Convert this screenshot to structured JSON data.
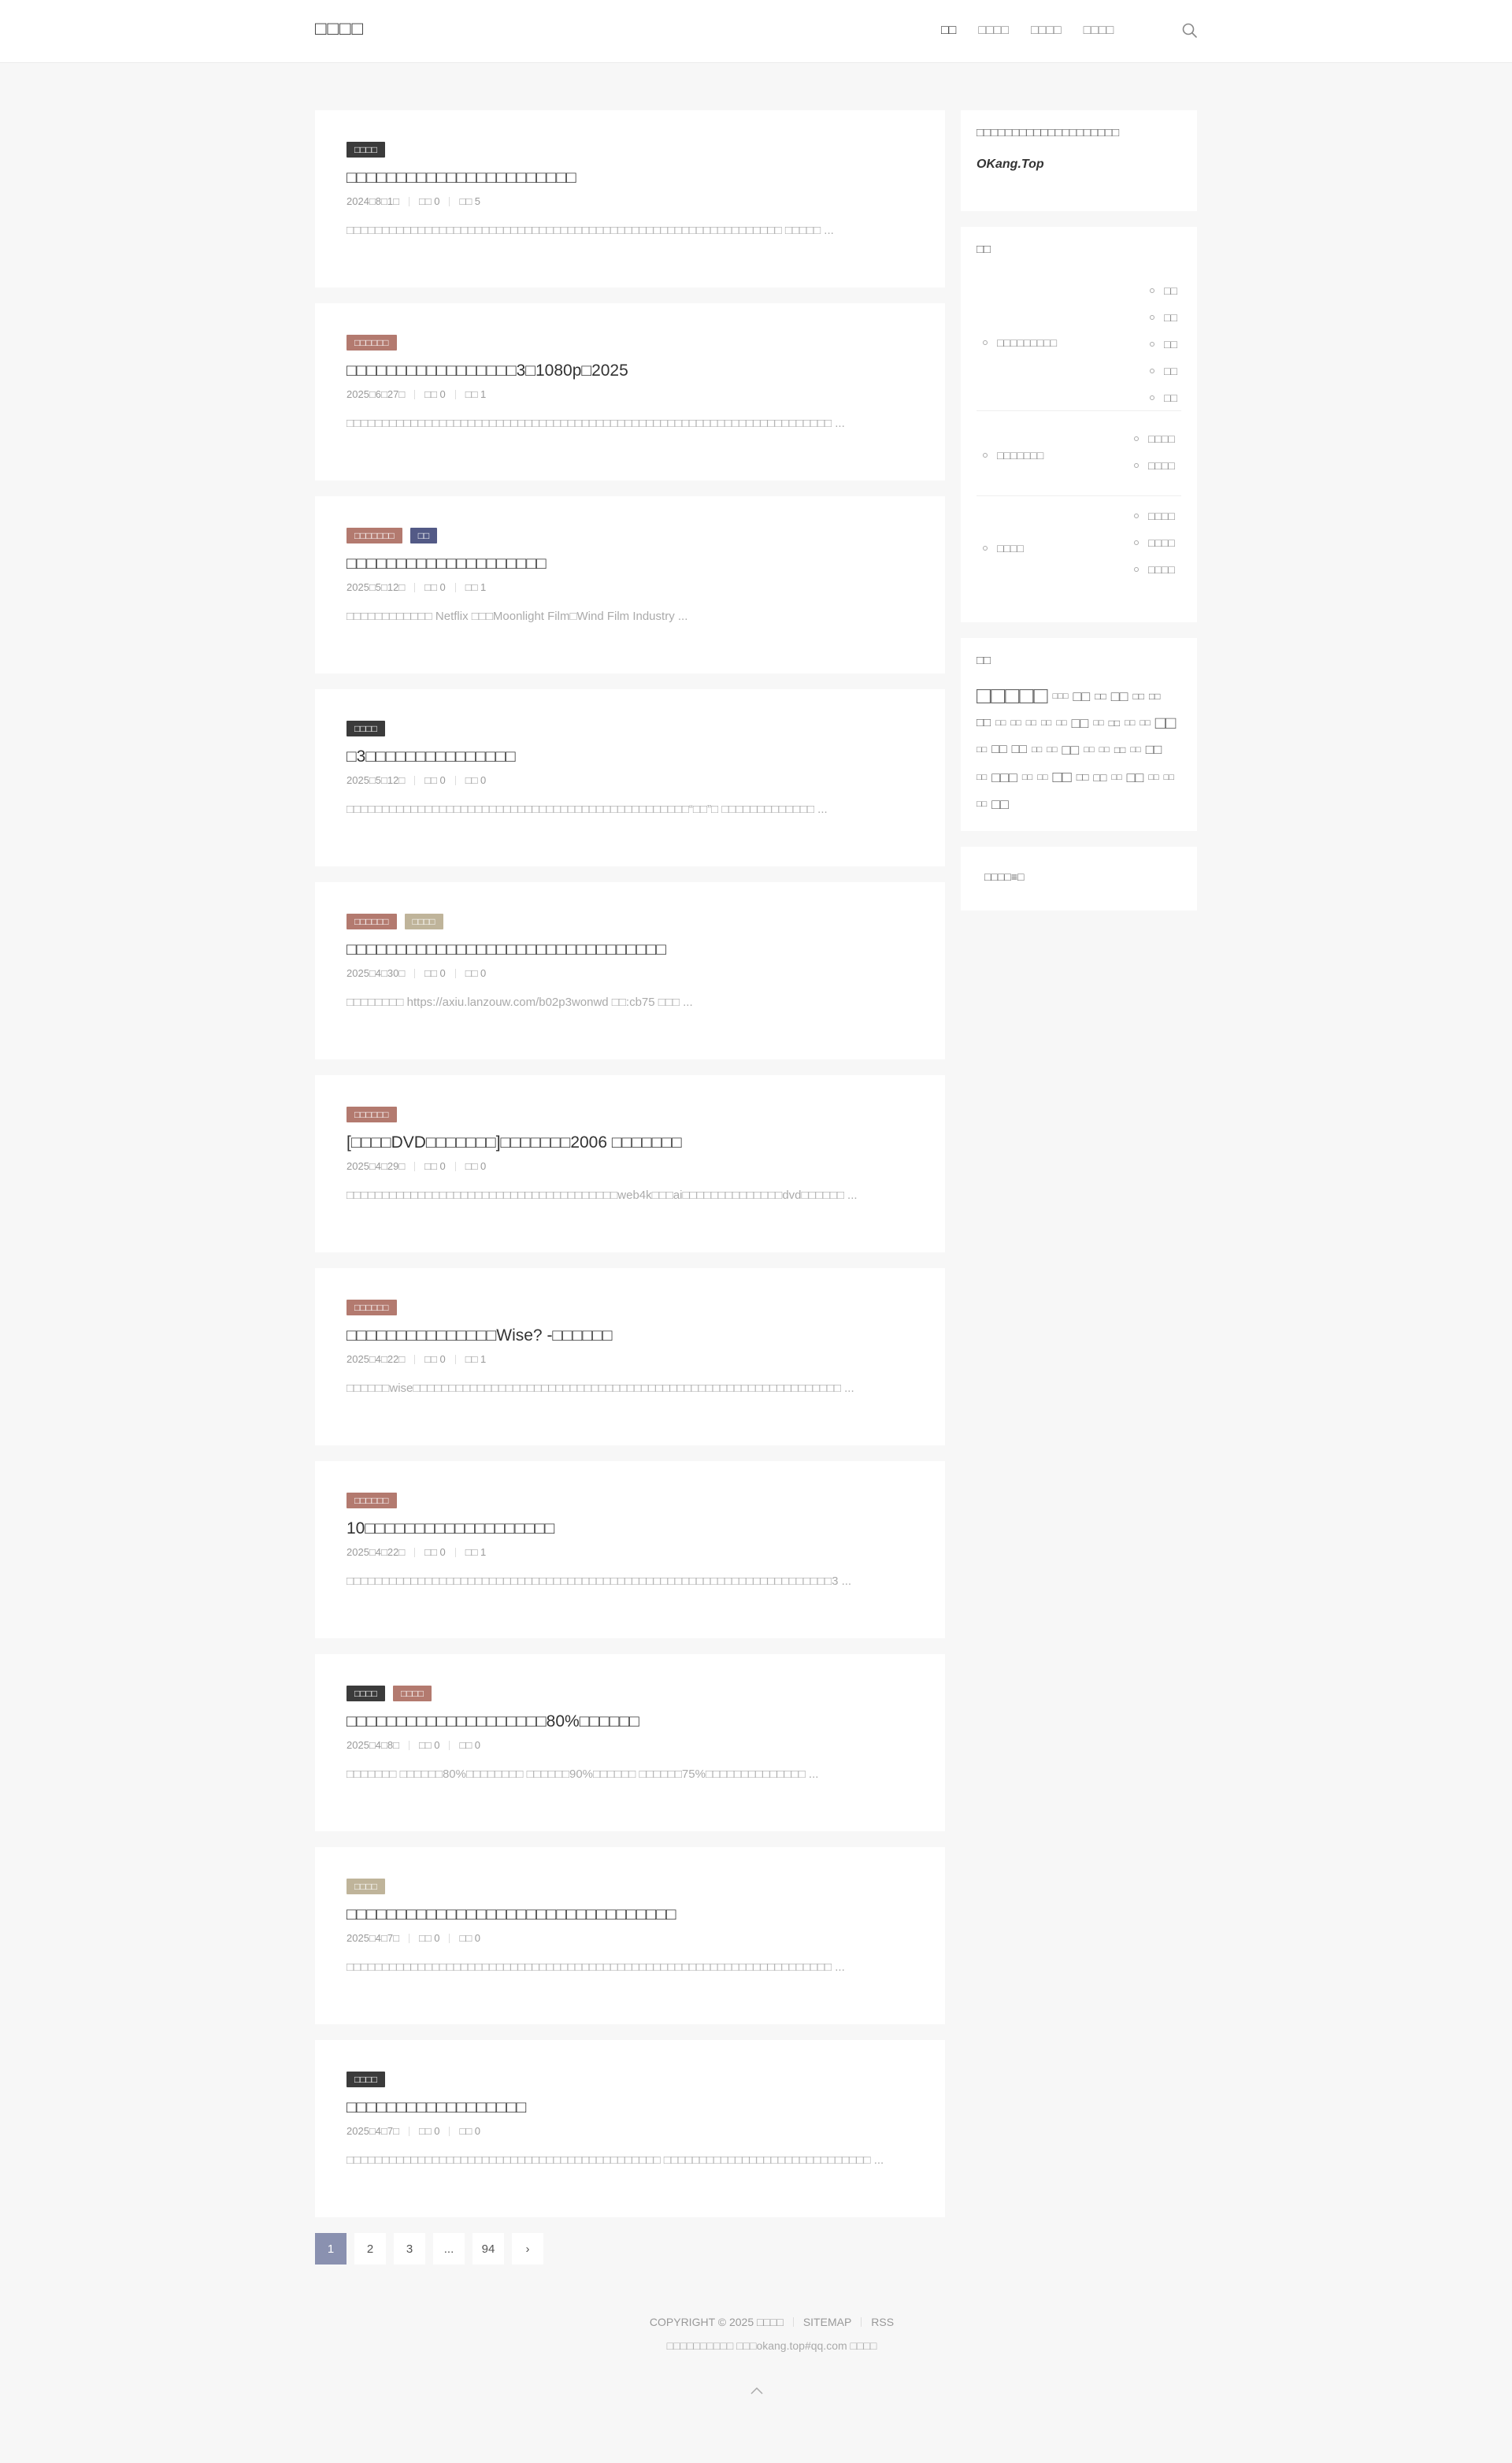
{
  "header": {
    "site_title": "□□□□",
    "nav": [
      "□□",
      "□□□□",
      "□□□□",
      "□□□□"
    ],
    "search_icon": "search-icon"
  },
  "posts": [
    {
      "cats": [
        {
          "label": "□□□□",
          "color": "#3b3b3b"
        }
      ],
      "title": "□□□□□□□□□□□□□□□□□□□□□□□",
      "date": "2024□8□1□",
      "comments": "□□ 0",
      "views": "□□ 5",
      "excerpt": "□□□□□□□□□□□□□□□□□□□□□□□□□□□□□□□□□□□□□□□□□□□□□□□□□□□□□□□□□□□□□ □□□□□ ..."
    },
    {
      "cats": [
        {
          "label": "□□□□□□",
          "color": "#b37a6f"
        }
      ],
      "title": "□□□□□□□□□□□□□□□□□3□1080p□2025",
      "date": "2025□6□27□",
      "comments": "□□ 0",
      "views": "□□ 1",
      "excerpt": "□□□□□□□□□□□□□□□□□□□□□□□□□□□□□□□□□□□□□□□□□□□□□□□□□□□□□□□□□□□□□□□□□□□□ ..."
    },
    {
      "cats": [
        {
          "label": "□□□□□□□",
          "color": "#b37a6f"
        },
        {
          "label": "□□",
          "color": "#535a86"
        }
      ],
      "title": "□□□□□□□□□□□□□□□□□□□□",
      "date": "2025□5□12□",
      "comments": "□□ 0",
      "views": "□□ 1",
      "excerpt": "□□□□□□□□□□□□ Netflix □□□Moonlight Film□Wind Film Industry ..."
    },
    {
      "cats": [
        {
          "label": "□□□□",
          "color": "#3b3b3b"
        }
      ],
      "title": "□3□□□□□□□□□□□□□□□",
      "date": "2025□5□12□",
      "comments": "□□ 0",
      "views": "□□ 0",
      "excerpt": "□□□□□□□□□□□□□□□□□□□□□□□□□□□□□□□□□□□□□□□□□□□□□□□□“□□”□ □□□□□□□□□□□□□ ..."
    },
    {
      "cats": [
        {
          "label": "□□□□□□",
          "color": "#b37a6f"
        },
        {
          "label": "□□□□",
          "color": "#bfb49a"
        }
      ],
      "title": "□□□□□□□□□□□□□□□□□□□□□□□□□□□□□□□□",
      "date": "2025□4□30□",
      "comments": "□□ 0",
      "views": "□□ 0",
      "excerpt": "□□□□□□□□ https://axiu.lanzouw.com/b02p3wonwd □□:cb75 □□□ ..."
    },
    {
      "cats": [
        {
          "label": "□□□□□□",
          "color": "#b37a6f"
        }
      ],
      "title": "[□□□□DVD□□□□□□□]□□□□□□□2006 □□□□□□□",
      "date": "2025□4□29□",
      "comments": "□□ 0",
      "views": "□□ 0",
      "excerpt": "□□□□□□□□□□□□□□□□□□□□□□□□□□□□□□□□□□□□□□web4k□□□ai□□□□□□□□□□□□□□dvd□□□□□□ ..."
    },
    {
      "cats": [
        {
          "label": "□□□□□□",
          "color": "#b37a6f"
        }
      ],
      "title": "□□□□□□□□□□□□□□□Wise? -□□□□□□",
      "date": "2025□4□22□",
      "comments": "□□ 0",
      "views": "□□ 1",
      "excerpt": "□□□□□□wise□□□□□□□□□□□□□□□□□□□□□□□□□□□□□□□□□□□□□□□□□□□□□□□□□□□□□□□□□□□□ ..."
    },
    {
      "cats": [
        {
          "label": "□□□□□□",
          "color": "#b37a6f"
        }
      ],
      "title": "10□□□□□□□□□□□□□□□□□□□",
      "date": "2025□4□22□",
      "comments": "□□ 0",
      "views": "□□ 1",
      "excerpt": "□□□□□□□□□□□□□□□□□□□□□□□□□□□□□□□□□□□□□□□□□□□□□□□□□□□□□□□□□□□□□□□□□□□□3 ..."
    },
    {
      "cats": [
        {
          "label": "□□□□",
          "color": "#3b3b3b"
        },
        {
          "label": "□□□□",
          "color": "#b37a6f"
        }
      ],
      "title": "□□□□□□□□□□□□□□□□□□□□80%□□□□□□",
      "date": "2025□4□8□",
      "comments": "□□ 0",
      "views": "□□ 0",
      "excerpt": "□□□□□□□ □□□□□□80%□□□□□□□□ □□□□□□90%□□□□□□ □□□□□□75%□□□□□□□□□□□□□□ ..."
    },
    {
      "cats": [
        {
          "label": "□□□□",
          "color": "#bfb49a"
        }
      ],
      "title": "□□□□□□□□□□□□□□□□□□□□□□□□□□□□□□□□□",
      "date": "2025□4□7□",
      "comments": "□□ 0",
      "views": "□□ 0",
      "excerpt": "□□□□□□□□□□□□□□□□□□□□□□□□□□□□□□□□□□□□□□□□□□□□□□□□□□□□□□□□□□□□□□□□□□□□ ..."
    },
    {
      "cats": [
        {
          "label": "□□□□",
          "color": "#3b3b3b"
        }
      ],
      "title": "□□□□□□□□□□□□□□□□□□",
      "date": "2025□4□7□",
      "comments": "□□ 0",
      "views": "□□ 0",
      "excerpt": "□□□□□□□□□□□□□□□□□□□□□□□□□□□□□□□□□□□□□□□□□□□□ □□□□□□□□□□□□□□□□□□□□□□□□□□□□□ ..."
    }
  ],
  "pagination": [
    "1",
    "2",
    "3",
    "...",
    "94",
    "›"
  ],
  "sidebar": {
    "about_title": "□□□□□□□□□□□□□□□□□□□□",
    "about_site": "OKang.Top",
    "menu_title": "□□",
    "menu": [
      {
        "label": "□□□□□□□□□",
        "children": [
          "□□",
          "□□",
          "□□",
          "□□",
          "□□"
        ]
      },
      {
        "label": "□□□□□□□",
        "children": [
          "□□□□",
          "□□□□"
        ]
      },
      {
        "label": "□□□□",
        "children": [
          "□□□□",
          "□□□□",
          "□□□□"
        ]
      }
    ],
    "tags_title": "□□",
    "tags": [
      {
        "t": "□□□□□",
        "s": 30
      },
      {
        "t": "□□□",
        "s": 11
      },
      {
        "t": "□□",
        "s": 18
      },
      {
        "t": "□□",
        "s": 12
      },
      {
        "t": "□□",
        "s": 18
      },
      {
        "t": "□□",
        "s": 12
      },
      {
        "t": "□□",
        "s": 12
      },
      {
        "t": "□□",
        "s": 15
      },
      {
        "t": "□□",
        "s": 11
      },
      {
        "t": "□□",
        "s": 11
      },
      {
        "t": "□□",
        "s": 11
      },
      {
        "t": "□□",
        "s": 11
      },
      {
        "t": "□□",
        "s": 11
      },
      {
        "t": "□□",
        "s": 18
      },
      {
        "t": "□□",
        "s": 11
      },
      {
        "t": "□□",
        "s": 12
      },
      {
        "t": "□□",
        "s": 11
      },
      {
        "t": "□□",
        "s": 11
      },
      {
        "t": "□□",
        "s": 22
      },
      {
        "t": "□□",
        "s": 11
      },
      {
        "t": "□□",
        "s": 16
      },
      {
        "t": "□□",
        "s": 16
      },
      {
        "t": "□□",
        "s": 11
      },
      {
        "t": "□□",
        "s": 11
      },
      {
        "t": "□□",
        "s": 18
      },
      {
        "t": "□□",
        "s": 11
      },
      {
        "t": "□□",
        "s": 11
      },
      {
        "t": "□□",
        "s": 12
      },
      {
        "t": "□□",
        "s": 11
      },
      {
        "t": "□□",
        "s": 17
      },
      {
        "t": "□□",
        "s": 11
      },
      {
        "t": "□□□",
        "s": 18
      },
      {
        "t": "□□",
        "s": 11
      },
      {
        "t": "□□",
        "s": 11
      },
      {
        "t": "□□",
        "s": 20
      },
      {
        "t": "□□",
        "s": 13
      },
      {
        "t": "□□",
        "s": 14
      },
      {
        "t": "□□",
        "s": 11
      },
      {
        "t": "□□",
        "s": 18
      },
      {
        "t": "□□",
        "s": 11
      },
      {
        "t": "□□",
        "s": 11
      },
      {
        "t": "□□",
        "s": 11
      },
      {
        "t": "□□",
        "s": 18
      }
    ],
    "button_label": "□□□□≡□"
  },
  "footer": {
    "copyright": "COPYRIGHT © 2025 □□□□",
    "sitemap": "SITEMAP",
    "rss": "RSS",
    "line2": "□□□□□□□□□□ □□□okang.top#qq.com □□□□"
  }
}
